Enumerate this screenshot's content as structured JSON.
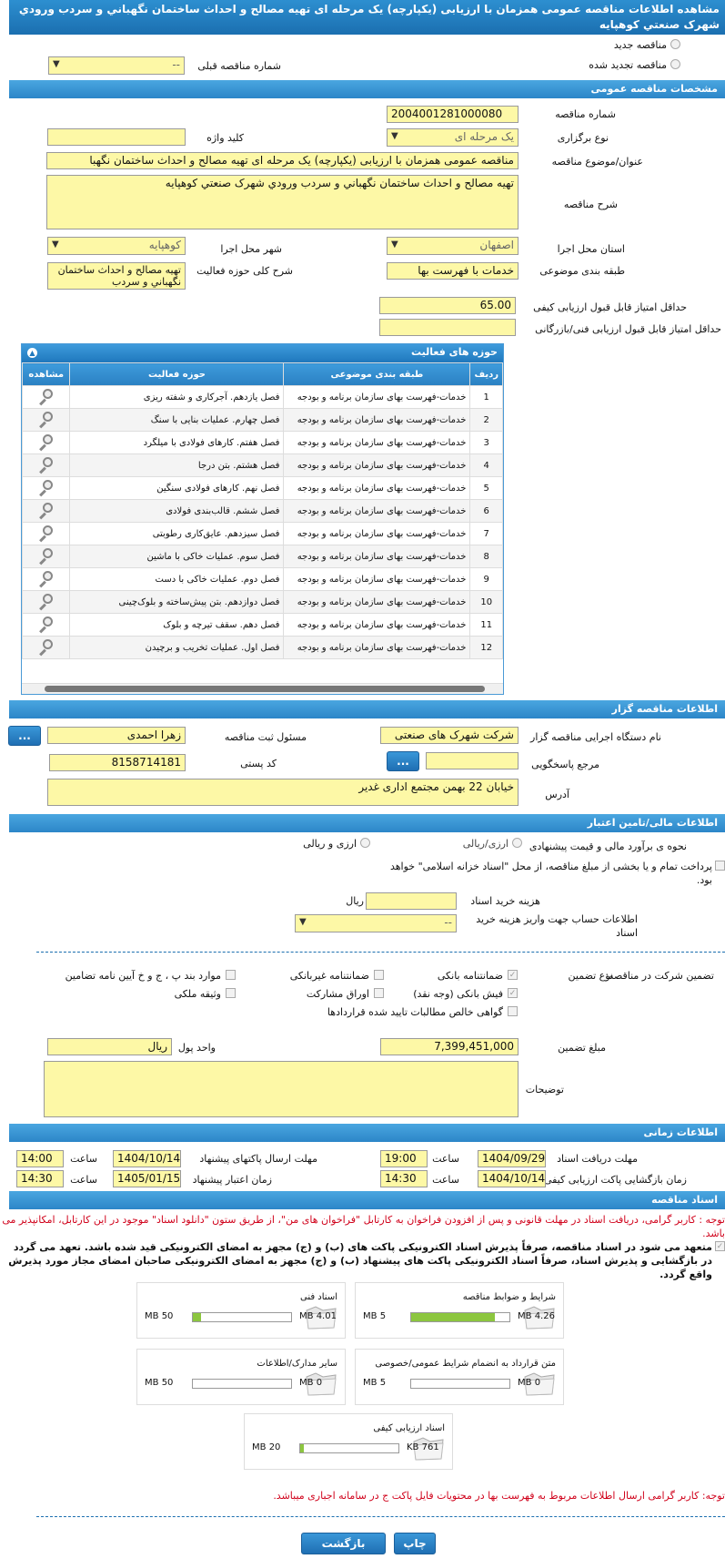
{
  "page": {
    "title": "مشاهده اطلاعات مناقصه عمومی همزمان با ارزیابی (یکپارچه) یک مرحله ای تهیه مصالح و احداث ساختمان نگهباني و سردب ورودي شهرک صنعتي کوهپايه"
  },
  "top": {
    "new": "مناقصه جدید",
    "renewed": "مناقصه تجدید شده",
    "prev_label": "شماره مناقصه قبلی",
    "prev_value": "--"
  },
  "general": {
    "header": "مشخصات مناقصه عمومی",
    "number_label": "شماره مناقصه",
    "number": "2004001281000080",
    "type_label": "نوع برگزاری",
    "type": "یک مرحله ای",
    "keyword_label": "کلید واژه",
    "keyword": "",
    "subject_label": "عنوان/موضوع مناقصه",
    "subject": "مناقصه عمومی همزمان با ارزیابی (یکپارچه) یک مرحله ای تهیه مصالح و احداث ساختمان نگهبا",
    "desc_label": "شرح مناقصه",
    "desc": "تهیه مصالح و احداث ساختمان نگهباني و سردب ورودي شهرک صنعتي کوهپايه",
    "province_label": "استان محل اجرا",
    "province": "اصفهان",
    "city_label": "شهر محل اجرا",
    "city": "کوهپایه",
    "category_label": "طبقه بندی موضوعی",
    "category": "خدمات با فهرست بها",
    "scope_label": "شرح کلی حوزه فعالیت",
    "scope": "تهیه مصالح و احداث ساختمان نگهباني و سردب",
    "min_quality_label": "حداقل امتیاز قابل قبول ارزیابی کیفی",
    "min_quality": "65.00",
    "min_tech_label": "حداقل امتیاز قابل قبول ارزیابی فنی/بازرگانی",
    "min_tech": ""
  },
  "activity": {
    "header": "حوزه های فعالیت",
    "cols": [
      "ردیف",
      "طبقه بندی موضوعی",
      "حوزه فعالیت",
      "مشاهده"
    ],
    "rows": [
      [
        "1",
        "خدمات-فهرست بهای سازمان برنامه و بودجه",
        "فصل یازدهم. آجرکاری و شفته ریزی"
      ],
      [
        "2",
        "خدمات-فهرست بهای سازمان برنامه و بودجه",
        "فصل چهارم. عملیات بنایی با سنگ"
      ],
      [
        "3",
        "خدمات-فهرست بهای سازمان برنامه و بودجه",
        "فصل هفتم. کارهای فولادی با میلگرد"
      ],
      [
        "4",
        "خدمات-فهرست بهای سازمان برنامه و بودجه",
        "فصل هشتم. بتن درجا"
      ],
      [
        "5",
        "خدمات-فهرست بهای سازمان برنامه و بودجه",
        "فصل نهم. کارهای فولادی سنگین"
      ],
      [
        "6",
        "خدمات-فهرست بهای سازمان برنامه و بودجه",
        "فصل ششم. قالب‌بندی فولادی"
      ],
      [
        "7",
        "خدمات-فهرست بهای سازمان برنامه و بودجه",
        "فصل سیزدهم. عایق‌کاری رطوبتی"
      ],
      [
        "8",
        "خدمات-فهرست بهای سازمان برنامه و بودجه",
        "فصل سوم. عملیات خاکی با ماشین"
      ],
      [
        "9",
        "خدمات-فهرست بهای سازمان برنامه و بودجه",
        "فصل دوم. عملیات خاکی با دست"
      ],
      [
        "10",
        "خدمات-فهرست بهای سازمان برنامه و بودجه",
        "فصل دوازدهم. بتن پیش‌ساخته و بلوک‌چینی"
      ],
      [
        "11",
        "خدمات-فهرست بهای سازمان برنامه و بودجه",
        "فصل دهم. سقف تیرچه و بلوک"
      ],
      [
        "12",
        "خدمات-فهرست بهای سازمان برنامه و بودجه",
        "فصل اول. عملیات تخریب و برچیدن"
      ]
    ]
  },
  "org": {
    "header": "اطلاعات مناقصه گزار",
    "name_label": "نام دستگاه اجرایی مناقصه گزار",
    "name": "شرکت شهرک های صنعتی",
    "registrar_label": "مسئول ثبت مناقصه",
    "registrar": "زهرا احمدی",
    "ref_label": "مرجع پاسخگویی",
    "ref": "",
    "postal_label": "کد پستی",
    "postal": "8158714181",
    "address_label": "آدرس",
    "address": "خیابان 22 بهمن مجتمع اداری غدیر",
    "dots": "..."
  },
  "finance": {
    "header": "اطلاعات مالی/تامین اعتبار",
    "method_label": "نحوه ی برآورد مالی و قیمت پیشنهادی",
    "opt1": "ارزی/ریالی",
    "opt2": "ارزی و ریالی",
    "treasury": "پرداخت تمام و یا بخشی از مبلغ مناقصه، از محل \"اسناد خزانه اسلامی\" خواهد بود.",
    "doc_cost_label": "هزینه خرید اسناد",
    "doc_cost": "",
    "doc_unit": "ریال",
    "account_label": "اطلاعات حساب جهت واریز هزینه خرید اسناد",
    "account": "--"
  },
  "guarantee": {
    "label": "تضمین شرکت در مناقصه:",
    "type_label": "نوع تضمین",
    "items": [
      "ضمانتنامه بانکی",
      "ضمانتنامه غیربانکی",
      "موارد بند پ ، ج و خ آیین نامه تضامین",
      "فیش بانکی (وجه نقد)",
      "اوراق مشارکت",
      "وثیقه ملکی",
      "گواهی خالص مطالبات تایید شده قراردادها"
    ],
    "amount_label": "مبلغ تضمین",
    "amount": "7,399,451,000",
    "unit_label": "واحد پول",
    "unit": "ریال",
    "notes_label": "توضیحات",
    "notes": ""
  },
  "time": {
    "header": "اطلاعات زمانی",
    "doc_deadline_label": "مهلت دریافت اسناد",
    "doc_deadline_date": "1404/09/29",
    "doc_deadline_time": "19:00",
    "send_label": "مهلت ارسال پاکتهای پیشنهاد",
    "send_date": "1404/10/14",
    "send_time": "14:00",
    "open_label": "زمان بازگشایی پاکت ارزیابی کیفی",
    "open_date": "1404/10/14",
    "open_time": "14:30",
    "valid_label": "زمان اعتبار پیشنهاد",
    "valid_date": "1405/01/15",
    "valid_time": "14:30",
    "hour": "ساعت"
  },
  "docs": {
    "header": "اسناد مناقصه",
    "note": "توجه : کاربر گرامی، دریافت اسناد در مهلت قانونی و پس از افزودن فراخوان به کارتابل \"فراخوان های من\"، از طریق ستون \"دانلود اسناد\" موجود در این کارتابل، امکانپذیر می باشد.",
    "commit": "متعهد می شود در اسناد مناقصه، صرفاً پذیرش اسناد الکترونیکی پاکت های (ب) و (ج) مجهز به امضای الکترونیکی قید شده باشد. تعهد می گردد در بازگشایی و پذیرش اسناد، صرفاً اسناد الکترونیکی پاکت های پیشنهاد (ب) و (ج) مجهز به امضای الکترونیکی صاحبان امضای مجاز مورد پذیرش واقع گردد.",
    "files": [
      {
        "name": "شرایط و ضوابط مناقصه",
        "cur": "4.26 MB",
        "max": "5 MB",
        "pct": 85
      },
      {
        "name": "اسناد فنی",
        "cur": "4.01 MB",
        "max": "50 MB",
        "pct": 8
      },
      {
        "name": "متن قرارداد به انضمام شرایط عمومی/خصوصی",
        "cur": "0 MB",
        "max": "5 MB",
        "pct": 0
      },
      {
        "name": "سایر مدارک/اطلاعات",
        "cur": "0 MB",
        "max": "50 MB",
        "pct": 0
      },
      {
        "name": "اسناد ارزیابی کیفی",
        "cur": "761 KB",
        "max": "20 MB",
        "pct": 4
      }
    ],
    "note2": "توجه: کاربر گرامی ارسال اطلاعات مربوط به فهرست بها در محتویات فایل پاکت ج در سامانه اجباری میباشد."
  },
  "buttons": {
    "print": "چاپ",
    "back": "بازگشت"
  },
  "colors": {
    "header": "#1b6fb0",
    "input": "#fdf8a6",
    "note": "#d0021b"
  }
}
